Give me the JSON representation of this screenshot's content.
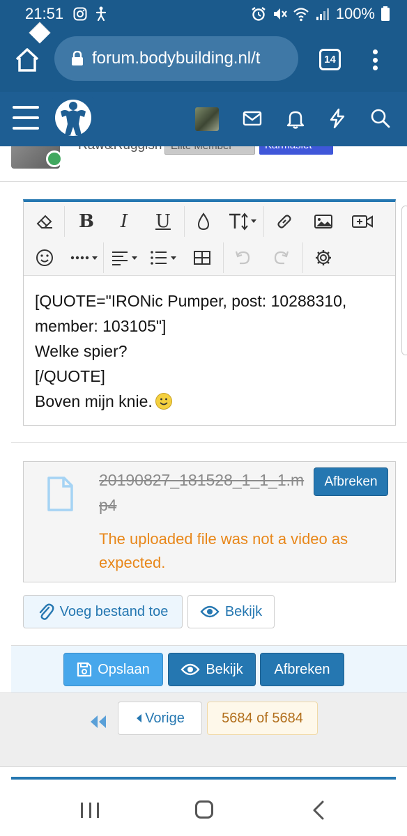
{
  "status_bar": {
    "time": "21:51",
    "battery": "100%"
  },
  "browser": {
    "url": "forum.bodybuilding.nl/t",
    "tab_count": "14"
  },
  "post": {
    "username": "Raw&Ruggish",
    "badge_elite": "Elite Member",
    "badge_karma": "Karmasiet"
  },
  "editor": {
    "lines": [
      "[QUOTE=\"IRONic Pumper, post: 10288310, member: 103105\"]",
      "Welke spier?",
      "[/QUOTE]",
      "Boven mijn knie."
    ]
  },
  "attachment": {
    "filename": "20190827_181528_1_1_1.mp4",
    "error": "The uploaded file was not a video as expected.",
    "abort_label": "Afbreken"
  },
  "attach_buttons": {
    "add_file": "Voeg bestand toe",
    "preview": "Bekijk"
  },
  "form_buttons": {
    "save": "Opslaan",
    "preview": "Bekijk",
    "cancel": "Afbreken"
  },
  "pagination": {
    "prev": "Vorige",
    "current": "5684 of 5684"
  },
  "colors": {
    "brand_dark": "#1b5a8c",
    "header": "#1e5e93",
    "primary_button": "#2577b1",
    "save_button": "#47a7eb",
    "error_text": "#e8871a"
  }
}
